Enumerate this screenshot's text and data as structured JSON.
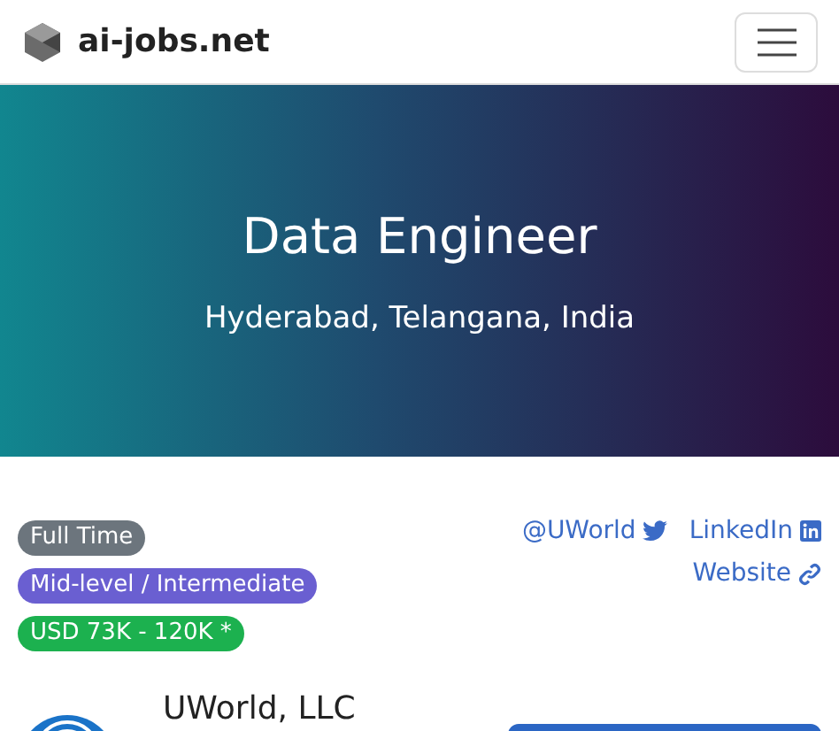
{
  "navbar": {
    "brand": "ai-jobs.net"
  },
  "hero": {
    "title": "Data Engineer",
    "location": "Hyderabad, Telangana, India"
  },
  "badges": [
    {
      "label": "Full Time",
      "color": "#6c757d"
    },
    {
      "label": "Mid-level / Intermediate",
      "color": "#6a5fd1"
    },
    {
      "label": "USD 73K - 120K *",
      "color": "#1cb14f"
    }
  ],
  "links": [
    {
      "label": "@UWorld",
      "kind": "twitter"
    },
    {
      "label": "LinkedIn",
      "kind": "linkedin"
    },
    {
      "label": "Website",
      "kind": "website"
    }
  ],
  "company": {
    "name": "UWorld, LLC"
  }
}
